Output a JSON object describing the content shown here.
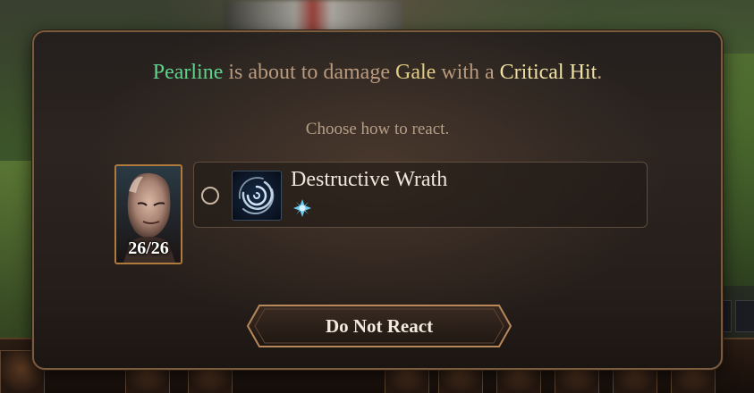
{
  "announcement": {
    "attacker": "Pearline",
    "text1": "is about to damage",
    "target": "Gale",
    "text2": "with a",
    "hit_type": "Critical Hit",
    "period": ".",
    "colors": {
      "attacker": "#5fd38d",
      "target": "#e0cc84",
      "hit_type": "#f0e0a2",
      "body": "#b89a7e"
    }
  },
  "instruction": "Choose how to react.",
  "portrait": {
    "hp": "26/26",
    "frame_color": "#b07a3c"
  },
  "reactions": [
    {
      "name": "Destructive Wrath",
      "icon": "spiral-vortex-icon",
      "cost_icon": "channel-divinity-starburst-icon",
      "selected": false
    }
  ],
  "button": {
    "label": "Do Not React"
  }
}
